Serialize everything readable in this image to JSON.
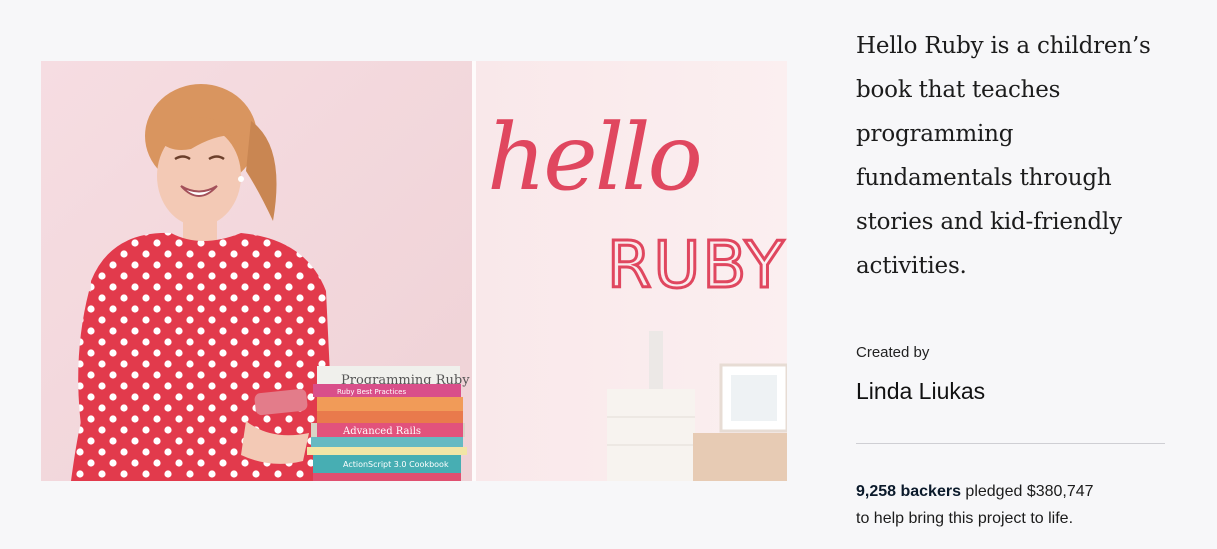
{
  "project": {
    "blurb": "Hello Ruby is a children’s book that teaches programming fundamentals through stories and kid-friendly activities.",
    "created_by_label": "Created by",
    "creator_name": "Linda Liukas",
    "backers": "9,258 backers",
    "pledged_text": " pledged $380,747",
    "help_text": "to help bring this project to life."
  },
  "hero": {
    "title_handwritten": "hello",
    "title_caps": "RUBY",
    "books": [
      "Programming Ruby",
      "Ruby Best Practices",
      "Advanced Rails",
      "ActionScript 3.0 Cookbook"
    ]
  },
  "colors": {
    "background": "#f7f7f9",
    "lettering": "#e0475f",
    "dress": "#e23a4c"
  }
}
